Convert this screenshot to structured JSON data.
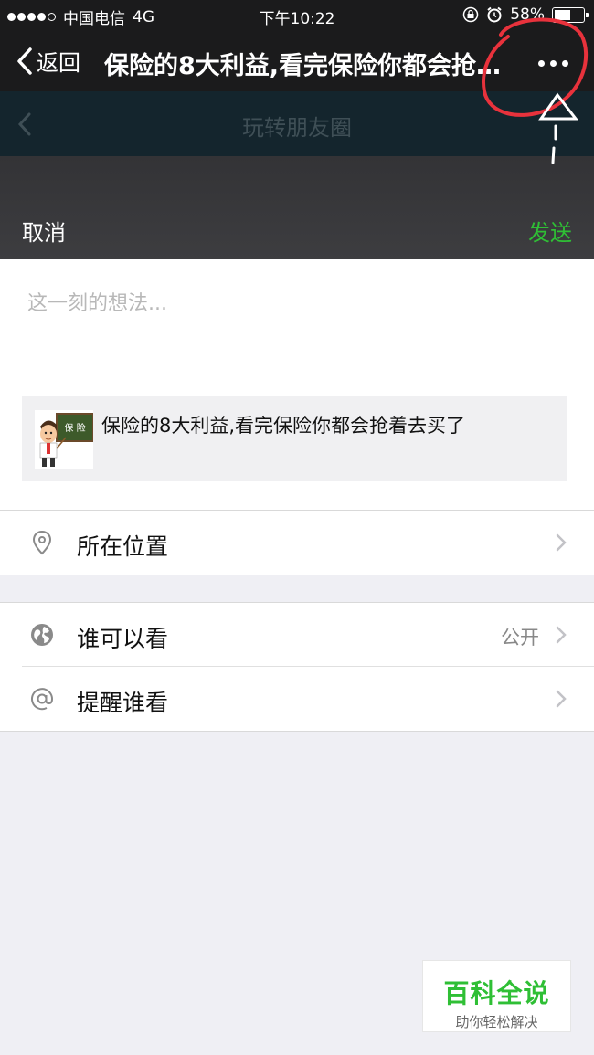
{
  "status_bar": {
    "carrier": "中国电信",
    "network": "4G",
    "time": "下午10:22",
    "battery_percent": "58%",
    "battery_level": 0.58
  },
  "nav": {
    "back_label": "返回",
    "title": "保险的8大利益,看完保险你都会抢着去买了",
    "more_icon": "more-dots-icon"
  },
  "underlay": {
    "title": "玩转朋友圈"
  },
  "compose": {
    "cancel_label": "取消",
    "send_label": "发送",
    "send_color": "#2fbf35",
    "input_placeholder": "这一刻的想法...",
    "link_card": {
      "thumb_text": "保 险",
      "title": "保险的8大利益,看完保险你都会抢着去买了"
    }
  },
  "settings": {
    "location": {
      "label": "所在位置",
      "icon": "location-pin-icon"
    },
    "who_can_see": {
      "label": "谁可以看",
      "value": "公开",
      "icon": "globe-icon"
    },
    "remind": {
      "label": "提醒谁看",
      "icon": "at-icon"
    }
  },
  "watermark": {
    "title": "百科全说",
    "subtitle": "助你轻松解决"
  }
}
